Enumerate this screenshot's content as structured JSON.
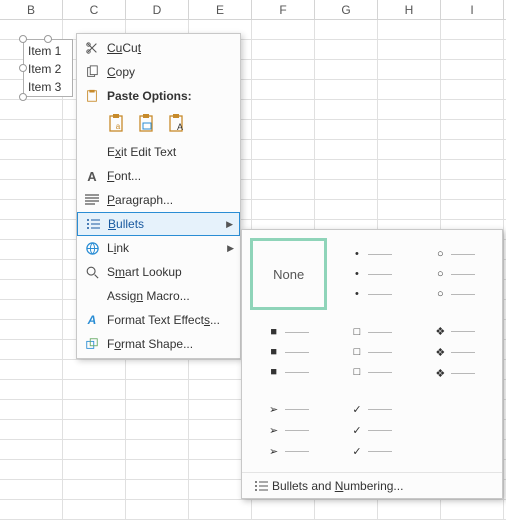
{
  "columns": [
    "B",
    "C",
    "D",
    "E",
    "F",
    "G",
    "H",
    "I"
  ],
  "textbox": {
    "items": [
      "Item 1",
      "Item 2",
      "Item 3"
    ]
  },
  "menu": {
    "cut": "Cut",
    "copy": "Copy",
    "paste_options": "Paste Options:",
    "exit_edit": "Exit Edit Text",
    "font": "Font...",
    "paragraph": "Paragraph...",
    "bullets": "Bullets",
    "link": "Link",
    "smart_lookup": "Smart Lookup",
    "assign_macro": "Assign Macro...",
    "format_text_effects": "Format Text Effects...",
    "format_shape": "Format Shape..."
  },
  "submenu": {
    "none": "None",
    "footer": "Bullets and Numbering..."
  }
}
